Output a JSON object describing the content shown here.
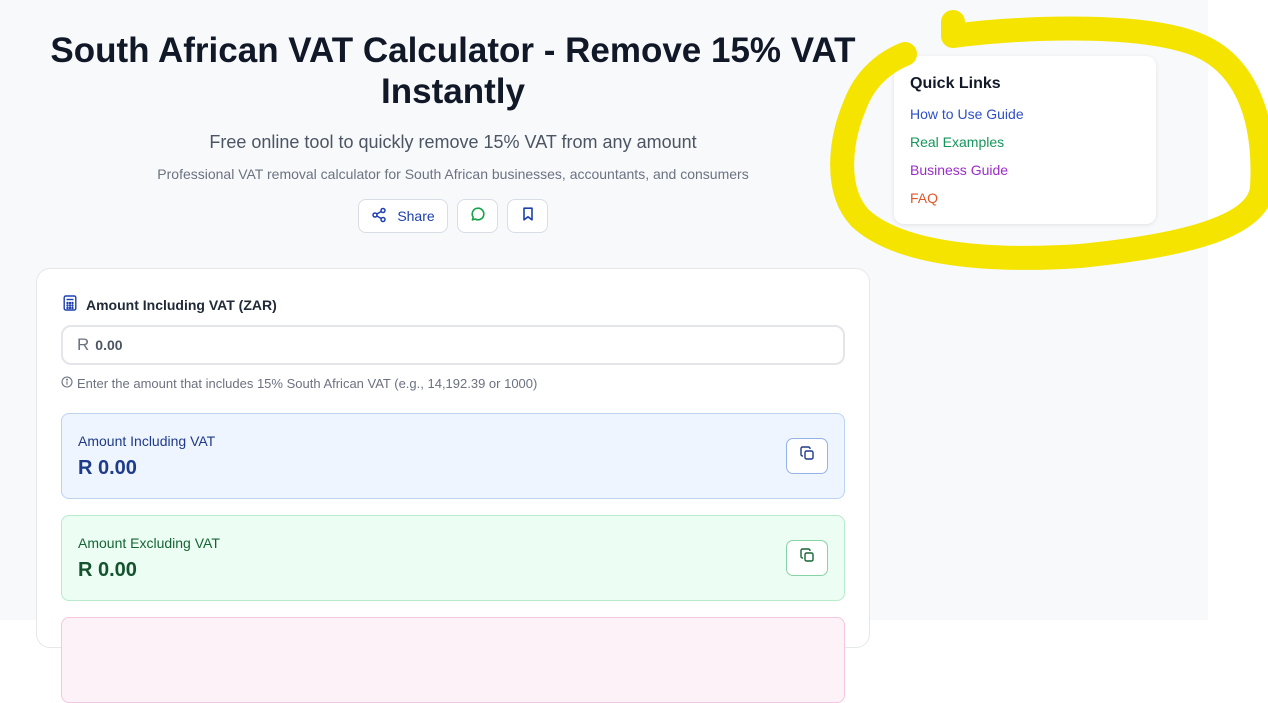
{
  "header": {
    "title": "South African VAT Calculator - Remove 15% VAT Instantly",
    "subtitle": "Free online tool to quickly remove 15% VAT from any amount",
    "tagline": "Professional VAT removal calculator for South African businesses, accountants, and consumers",
    "share_label": "Share"
  },
  "calculator": {
    "input_label": "Amount Including VAT (ZAR)",
    "currency_prefix": "R",
    "input_placeholder": "0.00",
    "input_value": "",
    "hint": "Enter the amount that includes 15% South African VAT (e.g., 14,192.39 or 1000)",
    "results": [
      {
        "label": "Amount Including VAT",
        "value": "R 0.00"
      },
      {
        "label": "Amount Excluding VAT",
        "value": "R 0.00"
      }
    ]
  },
  "quick_links": {
    "title": "Quick Links",
    "items": [
      {
        "label": "How to Use Guide",
        "color": "#2e4fc9"
      },
      {
        "label": "Real Examples",
        "color": "#15965a"
      },
      {
        "label": "Business Guide",
        "color": "#9b2cc7"
      },
      {
        "label": "FAQ",
        "color": "#e0572a"
      }
    ]
  },
  "annotation": {
    "color": "#f5e400"
  },
  "colors": {
    "page_bg": "#f8f9fb",
    "accent_blue": "#1e40af",
    "accent_green": "#16a34a"
  }
}
